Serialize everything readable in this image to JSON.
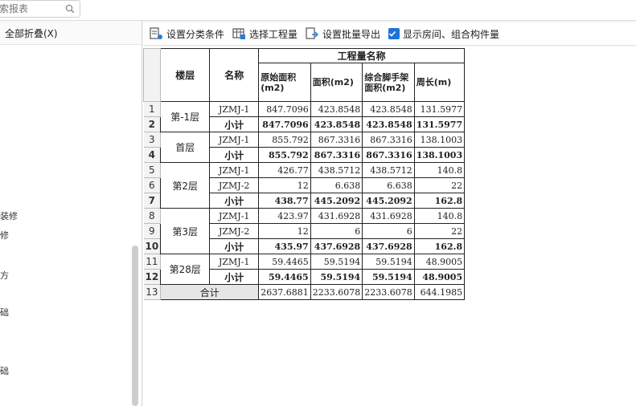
{
  "search": {
    "placeholder": "索报表"
  },
  "left_pane": {
    "collapse_label": "全部折叠(X)",
    "items": [
      "装修",
      "修",
      "方",
      "础",
      "础"
    ]
  },
  "toolbar": {
    "set_category_label": "设置分类条件",
    "select_quantity_label": "选择工程量",
    "batch_export_label": "设置批量导出",
    "show_rooms_label": "显示房间、组合构件量",
    "show_rooms_checked": true
  },
  "table": {
    "group_header": "工程量名称",
    "col_floor": "楼层",
    "col_name": "名称",
    "col_orig_area": "原始面积(m2)",
    "col_area": "面积(m2)",
    "col_scaffold_area": "综合脚手架面积(m2)",
    "col_perimeter": "周长(m)",
    "total_label": "合计",
    "rows": [
      {
        "n": "1",
        "floor": "第-1层",
        "name": "JZMJ-1",
        "v": [
          "847.7096",
          "423.8548",
          "423.8548",
          "131.5977"
        ]
      },
      {
        "n": "2",
        "name": "小计",
        "v": [
          "847.7096",
          "423.8548",
          "423.8548",
          "131.5977"
        ]
      },
      {
        "n": "3",
        "floor": "首层",
        "name": "JZMJ-1",
        "v": [
          "855.792",
          "867.3316",
          "867.3316",
          "138.1003"
        ]
      },
      {
        "n": "4",
        "name": "小计",
        "v": [
          "855.792",
          "867.3316",
          "867.3316",
          "138.1003"
        ]
      },
      {
        "n": "5",
        "floor": "第2层",
        "name": "JZMJ-1",
        "v": [
          "426.77",
          "438.5712",
          "438.5712",
          "140.8"
        ]
      },
      {
        "n": "6",
        "name": "JZMJ-2",
        "v": [
          "12",
          "6.638",
          "6.638",
          "22"
        ]
      },
      {
        "n": "7",
        "name": "小计",
        "v": [
          "438.77",
          "445.2092",
          "445.2092",
          "162.8"
        ]
      },
      {
        "n": "8",
        "floor": "第3层",
        "name": "JZMJ-1",
        "v": [
          "423.97",
          "431.6928",
          "431.6928",
          "140.8"
        ]
      },
      {
        "n": "9",
        "name": "JZMJ-2",
        "v": [
          "12",
          "6",
          "6",
          "22"
        ]
      },
      {
        "n": "10",
        "name": "小计",
        "v": [
          "435.97",
          "437.6928",
          "437.6928",
          "162.8"
        ]
      },
      {
        "n": "11",
        "floor": "第28层",
        "name": "JZMJ-1",
        "v": [
          "59.4465",
          "59.5194",
          "59.5194",
          "48.9005"
        ]
      },
      {
        "n": "12",
        "name": "小计",
        "v": [
          "59.4465",
          "59.5194",
          "59.5194",
          "48.9005"
        ]
      }
    ],
    "total_row": {
      "n": "13",
      "v": [
        "2637.6881",
        "2233.6078",
        "2233.6078",
        "644.1985"
      ]
    }
  }
}
